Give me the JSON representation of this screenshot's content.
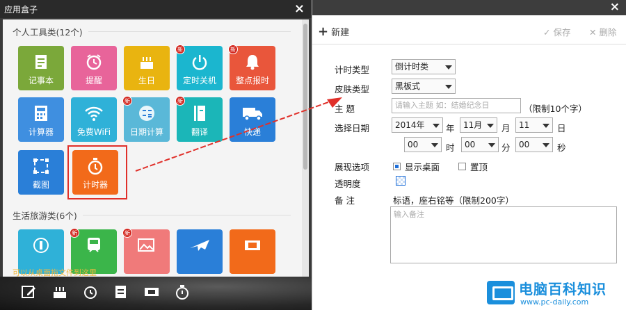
{
  "appbox": {
    "title": "应用盒子",
    "close": "×",
    "sections": [
      {
        "label": "个人工具类(12个)",
        "tiles": [
          {
            "label": "记事本",
            "color": "#7ba83a",
            "icon": "notepad-icon",
            "badge": ""
          },
          {
            "label": "提醒",
            "color": "#e8649a",
            "icon": "alarm-clock-icon",
            "badge": ""
          },
          {
            "label": "生日",
            "color": "#e9b410",
            "icon": "birthday-cake-icon",
            "badge": ""
          },
          {
            "label": "定时关机",
            "color": "#1bb6cf",
            "icon": "power-icon",
            "badge": "新"
          },
          {
            "label": "整点报时",
            "color": "#e9563b",
            "icon": "bell-icon",
            "badge": "新"
          },
          {
            "label": "计算器",
            "color": "#3f8fe0",
            "icon": "calculator-icon",
            "badge": ""
          },
          {
            "label": "免费WiFi",
            "color": "#2fb1d8",
            "icon": "wifi-icon",
            "badge": ""
          },
          {
            "label": "日期计算",
            "color": "#5ab8d8",
            "icon": "date-calc-icon",
            "badge": "新"
          },
          {
            "label": "翻译",
            "color": "#1bb6b8",
            "icon": "translate-book-icon",
            "badge": "新"
          },
          {
            "label": "快递",
            "color": "#2a7fd8",
            "icon": "truck-icon",
            "badge": ""
          },
          {
            "label": "截图",
            "color": "#2a7fd8",
            "icon": "screenshot-icon",
            "badge": ""
          },
          {
            "label": "计时器",
            "color": "#f26a1a",
            "icon": "stopwatch-icon",
            "badge": ""
          }
        ]
      },
      {
        "label": "生活旅游类(6个)",
        "tiles": [
          {
            "label": "",
            "color": "#2fb1d8",
            "icon": "holiday-icon",
            "badge": ""
          },
          {
            "label": "",
            "color": "#3bb54a",
            "icon": "train-icon",
            "badge": "新"
          },
          {
            "label": "",
            "color": "#f07a7a",
            "icon": "photo-icon",
            "badge": "新"
          },
          {
            "label": "",
            "color": "#2a7fd8",
            "icon": "airplane-icon",
            "badge": ""
          },
          {
            "label": "",
            "color": "#f26a1a",
            "icon": "ticket-icon",
            "badge": ""
          }
        ]
      }
    ],
    "hint": "可以从桌面拖文件到这里",
    "dock": [
      "edit-icon",
      "birthday-cake-icon",
      "alarm-clock-icon",
      "notepad-icon",
      "ticket-icon",
      "stopwatch-icon"
    ]
  },
  "editor": {
    "close": "×",
    "toolbar": {
      "new": "新建",
      "save": "✓ 保存",
      "delete": "✕ 删除"
    },
    "fields": {
      "timer_type_label": "计时类型",
      "timer_type_value": "倒计时类",
      "skin_type_label": "皮肤类型",
      "skin_type_value": "黑板式",
      "subject_label": "主    题",
      "subject_placeholder": "请输入主题 如：结婚纪念日",
      "subject_limit": "（限制10个字）",
      "date_label": "选择日期",
      "year_value": "2014年",
      "year_unit": "年",
      "month_value": "11月",
      "month_unit": "月",
      "day_value": "11",
      "day_unit": "日",
      "hour_value": "00",
      "hour_unit": "时",
      "minute_value": "00",
      "minute_unit": "分",
      "second_value": "00",
      "second_unit": "秒",
      "display_label": "展现选项",
      "show_desktop": "显示桌面",
      "pin_top": "置顶",
      "opacity_label": "透明度",
      "note_label": "备    注",
      "note_hint": "标语，座右铭等（限制200字）",
      "note_placeholder": "输入备注"
    }
  },
  "watermark": {
    "title": "电脑百科知识",
    "url": "www.pc-daily.com"
  },
  "colors": {
    "accent": "#1e6fd9",
    "highlight": "#e0302a"
  }
}
